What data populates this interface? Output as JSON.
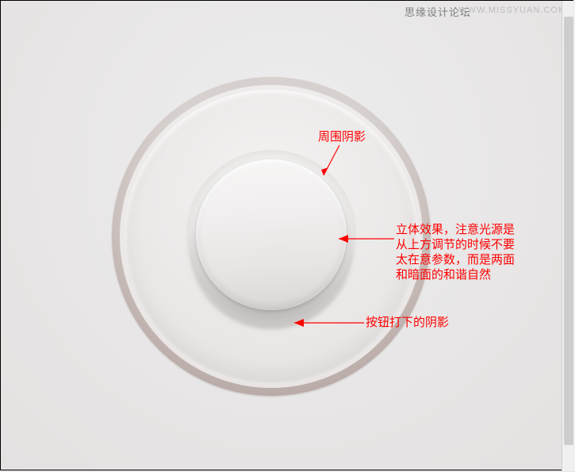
{
  "watermark": {
    "title": "思缘设计论坛",
    "url": "WWW.MISSYUAN.COM"
  },
  "annotations": {
    "top": {
      "label": "周围阴影"
    },
    "middle": {
      "label": "立体效果，注意光源是从上方调节的时候不要太在意参数，而是两面和暗面的和谐自然"
    },
    "bottom": {
      "label": "按钮打下的阴影"
    }
  }
}
